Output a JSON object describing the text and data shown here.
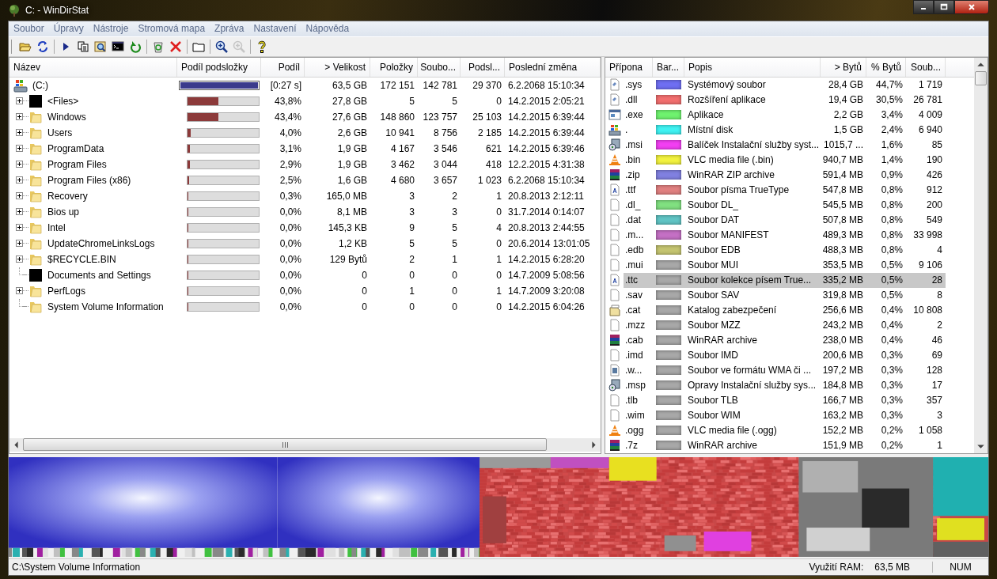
{
  "window": {
    "title": "C: - WinDirStat"
  },
  "menu": [
    "Soubor",
    "Úpravy",
    "Nástroje",
    "Stromová mapa",
    "Zpráva",
    "Nastavení",
    "Nápověda"
  ],
  "toolbar_groups": [
    {
      "buttons": [
        {
          "kind": "open",
          "disabled": false
        },
        {
          "kind": "rescan",
          "disabled": false
        }
      ]
    },
    {
      "buttons": [
        {
          "kind": "play",
          "disabled": false
        },
        {
          "kind": "copy",
          "disabled": false
        },
        {
          "kind": "explore",
          "disabled": false
        },
        {
          "kind": "console",
          "disabled": false
        },
        {
          "kind": "refresh",
          "disabled": false
        }
      ]
    },
    {
      "buttons": [
        {
          "kind": "recycle",
          "disabled": false
        },
        {
          "kind": "delete",
          "disabled": false
        }
      ]
    },
    {
      "buttons": [
        {
          "kind": "folder",
          "disabled": false
        }
      ]
    },
    {
      "buttons": [
        {
          "kind": "zoom-in",
          "disabled": false
        },
        {
          "kind": "zoom-out",
          "disabled": true
        }
      ]
    },
    {
      "buttons": [
        {
          "kind": "help",
          "disabled": false
        }
      ]
    }
  ],
  "tree": {
    "columns": [
      "Název",
      "Podíl podsložky",
      "Podíl",
      "> Velikost",
      "Položky",
      "Soubo...",
      "Podsl...",
      "Poslední změna"
    ],
    "rows": [
      {
        "name": "(C:)",
        "kind": "drive",
        "level": 1,
        "share": "[0:27 s]",
        "size": "63,5 GB",
        "items": "172 151",
        "files": "142 781",
        "subdirs": "29 370",
        "modified": "6.2.2068  15:10:34",
        "children": [
          {
            "name": "<Files>",
            "kind": "files",
            "expandable": true,
            "level": 0.438,
            "share": "43,8%",
            "size": "27,8 GB",
            "items": "5",
            "files": "5",
            "subdirs": "0",
            "modified": "14.2.2015  2:05:21"
          },
          {
            "name": "Windows",
            "kind": "folder",
            "expandable": true,
            "level": 0.434,
            "share": "43,4%",
            "size": "27,6 GB",
            "items": "148 860",
            "files": "123 757",
            "subdirs": "25 103",
            "modified": "14.2.2015  6:39:44"
          },
          {
            "name": "Users",
            "kind": "folder",
            "expandable": true,
            "level": 0.04,
            "share": "4,0%",
            "size": "2,6 GB",
            "items": "10 941",
            "files": "8 756",
            "subdirs": "2 185",
            "modified": "14.2.2015  6:39:44"
          },
          {
            "name": "ProgramData",
            "kind": "folder",
            "expandable": true,
            "level": 0.031,
            "share": "3,1%",
            "size": "1,9 GB",
            "items": "4 167",
            "files": "3 546",
            "subdirs": "621",
            "modified": "14.2.2015  6:39:46"
          },
          {
            "name": "Program Files",
            "kind": "folder",
            "expandable": true,
            "level": 0.029,
            "share": "2,9%",
            "size": "1,9 GB",
            "items": "3 462",
            "files": "3 044",
            "subdirs": "418",
            "modified": "12.2.2015  4:31:38"
          },
          {
            "name": "Program Files (x86)",
            "kind": "folder",
            "expandable": true,
            "level": 0.025,
            "share": "2,5%",
            "size": "1,6 GB",
            "items": "4 680",
            "files": "3 657",
            "subdirs": "1 023",
            "modified": "6.2.2068  15:10:34"
          },
          {
            "name": "Recovery",
            "kind": "folder",
            "expandable": true,
            "level": 0.003,
            "share": "0,3%",
            "size": "165,0 MB",
            "items": "3",
            "files": "2",
            "subdirs": "1",
            "modified": "20.8.2013  2:12:11"
          },
          {
            "name": "Bios up",
            "kind": "folder",
            "expandable": true,
            "level": 0,
            "share": "0,0%",
            "size": "8,1 MB",
            "items": "3",
            "files": "3",
            "subdirs": "0",
            "modified": "31.7.2014  0:14:07"
          },
          {
            "name": "Intel",
            "kind": "folder",
            "expandable": true,
            "level": 0,
            "share": "0,0%",
            "size": "145,3 KB",
            "items": "9",
            "files": "5",
            "subdirs": "4",
            "modified": "20.8.2013  2:44:55"
          },
          {
            "name": "UpdateChromeLinksLogs",
            "kind": "folder",
            "expandable": true,
            "level": 0,
            "share": "0,0%",
            "size": "1,2 KB",
            "items": "5",
            "files": "5",
            "subdirs": "0",
            "modified": "20.6.2014  13:01:05"
          },
          {
            "name": "$RECYCLE.BIN",
            "kind": "folder",
            "expandable": true,
            "level": 0,
            "share": "0,0%",
            "size": "129 Bytů",
            "items": "2",
            "files": "1",
            "subdirs": "1",
            "modified": "14.2.2015  6:28:20"
          },
          {
            "name": "Documents and Settings",
            "kind": "files",
            "expandable": false,
            "level": 0,
            "share": "0,0%",
            "size": "0",
            "items": "0",
            "files": "0",
            "subdirs": "0",
            "modified": "14.7.2009  5:08:56"
          },
          {
            "name": "PerfLogs",
            "kind": "folder",
            "expandable": true,
            "level": 0,
            "share": "0,0%",
            "size": "0",
            "items": "1",
            "files": "0",
            "subdirs": "1",
            "modified": "14.7.2009  3:20:08"
          },
          {
            "name": "System Volume Information",
            "kind": "folder",
            "expandable": false,
            "level": 0,
            "share": "0,0%",
            "size": "0",
            "items": "0",
            "files": "0",
            "subdirs": "0",
            "modified": "14.2.2015  6:04:26"
          }
        ]
      }
    ]
  },
  "extensions": {
    "columns": [
      "Přípona",
      "Bar...",
      "Popis",
      "> Bytů",
      "% Bytů",
      "Soub..."
    ],
    "rows": [
      {
        "ext": ".sys",
        "kind": "system",
        "color": "#6f6ff2",
        "description": "Systémový soubor",
        "bytes": "28,4 GB",
        "percent": "44,7%",
        "files": "1 719",
        "selected": false
      },
      {
        "ext": ".dll",
        "kind": "system",
        "color": "#f26f6f",
        "description": "Rozšíření aplikace",
        "bytes": "19,4 GB",
        "percent": "30,5%",
        "files": "26 781",
        "selected": false
      },
      {
        "ext": ".exe",
        "kind": "app",
        "color": "#6ff26f",
        "description": "Aplikace",
        "bytes": "2,2 GB",
        "percent": "3,4%",
        "files": "4 009",
        "selected": false
      },
      {
        "ext": ".",
        "kind": "drive",
        "color": "#3ff2f2",
        "description": "Místní disk",
        "bytes": "1,5 GB",
        "percent": "2,4%",
        "files": "6 940",
        "selected": false
      },
      {
        "ext": ".msi",
        "kind": "installer",
        "color": "#f23ff2",
        "description": "Balíček Instalační služby syst...",
        "bytes": "1015,7 ...",
        "percent": "1,6%",
        "files": "85",
        "selected": false
      },
      {
        "ext": ".bin",
        "kind": "cone",
        "color": "#f2f23f",
        "description": "VLC media file (.bin)",
        "bytes": "940,7 MB",
        "percent": "1,4%",
        "files": "190",
        "selected": false
      },
      {
        "ext": ".zip",
        "kind": "archive",
        "color": "#8080e0",
        "description": "WinRAR ZIP archive",
        "bytes": "591,4 MB",
        "percent": "0,9%",
        "files": "426",
        "selected": false
      },
      {
        "ext": ".ttf",
        "kind": "font",
        "color": "#e08080",
        "description": "Soubor písma TrueType",
        "bytes": "547,8 MB",
        "percent": "0,8%",
        "files": "912",
        "selected": false
      },
      {
        "ext": ".dl_",
        "kind": "blank",
        "color": "#80e080",
        "description": "Soubor DL_",
        "bytes": "545,5 MB",
        "percent": "0,8%",
        "files": "200",
        "selected": false
      },
      {
        "ext": ".dat",
        "kind": "blank",
        "color": "#60c4c4",
        "description": "Soubor DAT",
        "bytes": "507,8 MB",
        "percent": "0,8%",
        "files": "549",
        "selected": false
      },
      {
        "ext": ".m...",
        "kind": "blank",
        "color": "#c470c4",
        "description": "Soubor MANIFEST",
        "bytes": "489,3 MB",
        "percent": "0,8%",
        "files": "33 998",
        "selected": false
      },
      {
        "ext": ".edb",
        "kind": "blank",
        "color": "#c4c470",
        "description": "Soubor EDB",
        "bytes": "488,3 MB",
        "percent": "0,8%",
        "files": "4",
        "selected": false
      },
      {
        "ext": ".mui",
        "kind": "blank",
        "color": "#a8a8a8",
        "description": "Soubor MUI",
        "bytes": "353,5 MB",
        "percent": "0,5%",
        "files": "9 106",
        "selected": false
      },
      {
        "ext": ".ttc",
        "kind": "font",
        "color": "#a8a8a8",
        "description": "Soubor kolekce písem True...",
        "bytes": "335,2 MB",
        "percent": "0,5%",
        "files": "28",
        "selected": true
      },
      {
        "ext": ".sav",
        "kind": "blank",
        "color": "#a8a8a8",
        "description": "Soubor SAV",
        "bytes": "319,8 MB",
        "percent": "0,5%",
        "files": "8",
        "selected": false
      },
      {
        "ext": ".cat",
        "kind": "catalog",
        "color": "#a8a8a8",
        "description": "Katalog zabezpečení",
        "bytes": "256,6 MB",
        "percent": "0,4%",
        "files": "10 808",
        "selected": false
      },
      {
        "ext": ".mzz",
        "kind": "blank",
        "color": "#a8a8a8",
        "description": "Soubor MZZ",
        "bytes": "243,2 MB",
        "percent": "0,4%",
        "files": "2",
        "selected": false
      },
      {
        "ext": ".cab",
        "kind": "archive",
        "color": "#a8a8a8",
        "description": "WinRAR archive",
        "bytes": "238,0 MB",
        "percent": "0,4%",
        "files": "46",
        "selected": false
      },
      {
        "ext": ".imd",
        "kind": "blank",
        "color": "#a8a8a8",
        "description": "Soubor IMD",
        "bytes": "200,6 MB",
        "percent": "0,3%",
        "files": "69",
        "selected": false
      },
      {
        "ext": ".w...",
        "kind": "media",
        "color": "#a8a8a8",
        "description": "Soubor ve formátu WMA či ...",
        "bytes": "197,2 MB",
        "percent": "0,3%",
        "files": "128",
        "selected": false
      },
      {
        "ext": ".msp",
        "kind": "installer",
        "color": "#a8a8a8",
        "description": "Opravy Instalační služby sys...",
        "bytes": "184,8 MB",
        "percent": "0,3%",
        "files": "17",
        "selected": false
      },
      {
        "ext": ".tlb",
        "kind": "blank",
        "color": "#a8a8a8",
        "description": "Soubor TLB",
        "bytes": "166,7 MB",
        "percent": "0,3%",
        "files": "357",
        "selected": false
      },
      {
        "ext": ".wim",
        "kind": "blank",
        "color": "#a8a8a8",
        "description": "Soubor WIM",
        "bytes": "163,2 MB",
        "percent": "0,3%",
        "files": "3",
        "selected": false
      },
      {
        "ext": ".ogg",
        "kind": "cone",
        "color": "#a8a8a8",
        "description": "VLC media file (.ogg)",
        "bytes": "152,2 MB",
        "percent": "0,2%",
        "files": "1 058",
        "selected": false
      },
      {
        "ext": ".7z",
        "kind": "archive",
        "color": "#a8a8a8",
        "description": "WinRAR archive",
        "bytes": "151,9 MB",
        "percent": "0,2%",
        "files": "1",
        "selected": false
      }
    ]
  },
  "status_bar": {
    "path": "C:\\System Volume Information",
    "ram_label": "Využití RAM:",
    "ram_value": "63,5 MB",
    "num": "NUM"
  }
}
